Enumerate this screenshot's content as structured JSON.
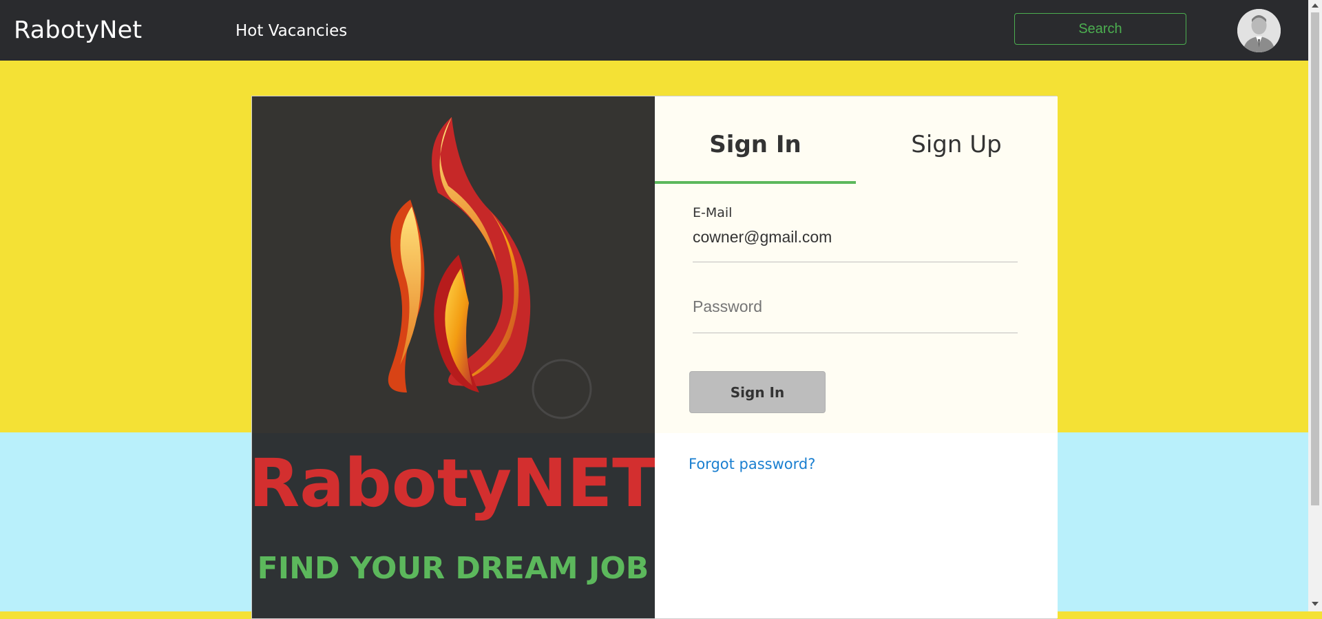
{
  "navbar": {
    "brand": "RabotyNet",
    "hot_vacancies": "Hot Vacancies",
    "search_label": "Search",
    "avatar_icon": "user-avatar-icon"
  },
  "logo": {
    "title": "RabotyNET",
    "tagline": "FIND YOUR DREAM JOB",
    "colors": {
      "title": "#d32f2f",
      "tagline": "#5cb85c"
    }
  },
  "auth": {
    "tabs": [
      {
        "label": "Sign In",
        "active": true
      },
      {
        "label": "Sign Up",
        "active": false
      }
    ],
    "email": {
      "label": "E-Mail",
      "value": "cowner@gmail.com"
    },
    "password": {
      "placeholder": "Password",
      "masked_value": "•••••"
    },
    "submit_label": "Sign In",
    "forgot_label": "Forgot password?"
  },
  "colors": {
    "accent": "#5cb85c",
    "navbar_bg": "#2a2b2e",
    "page_top": "#f4e135",
    "page_bottom": "#b9f0fb",
    "link": "#1a7fd0"
  }
}
